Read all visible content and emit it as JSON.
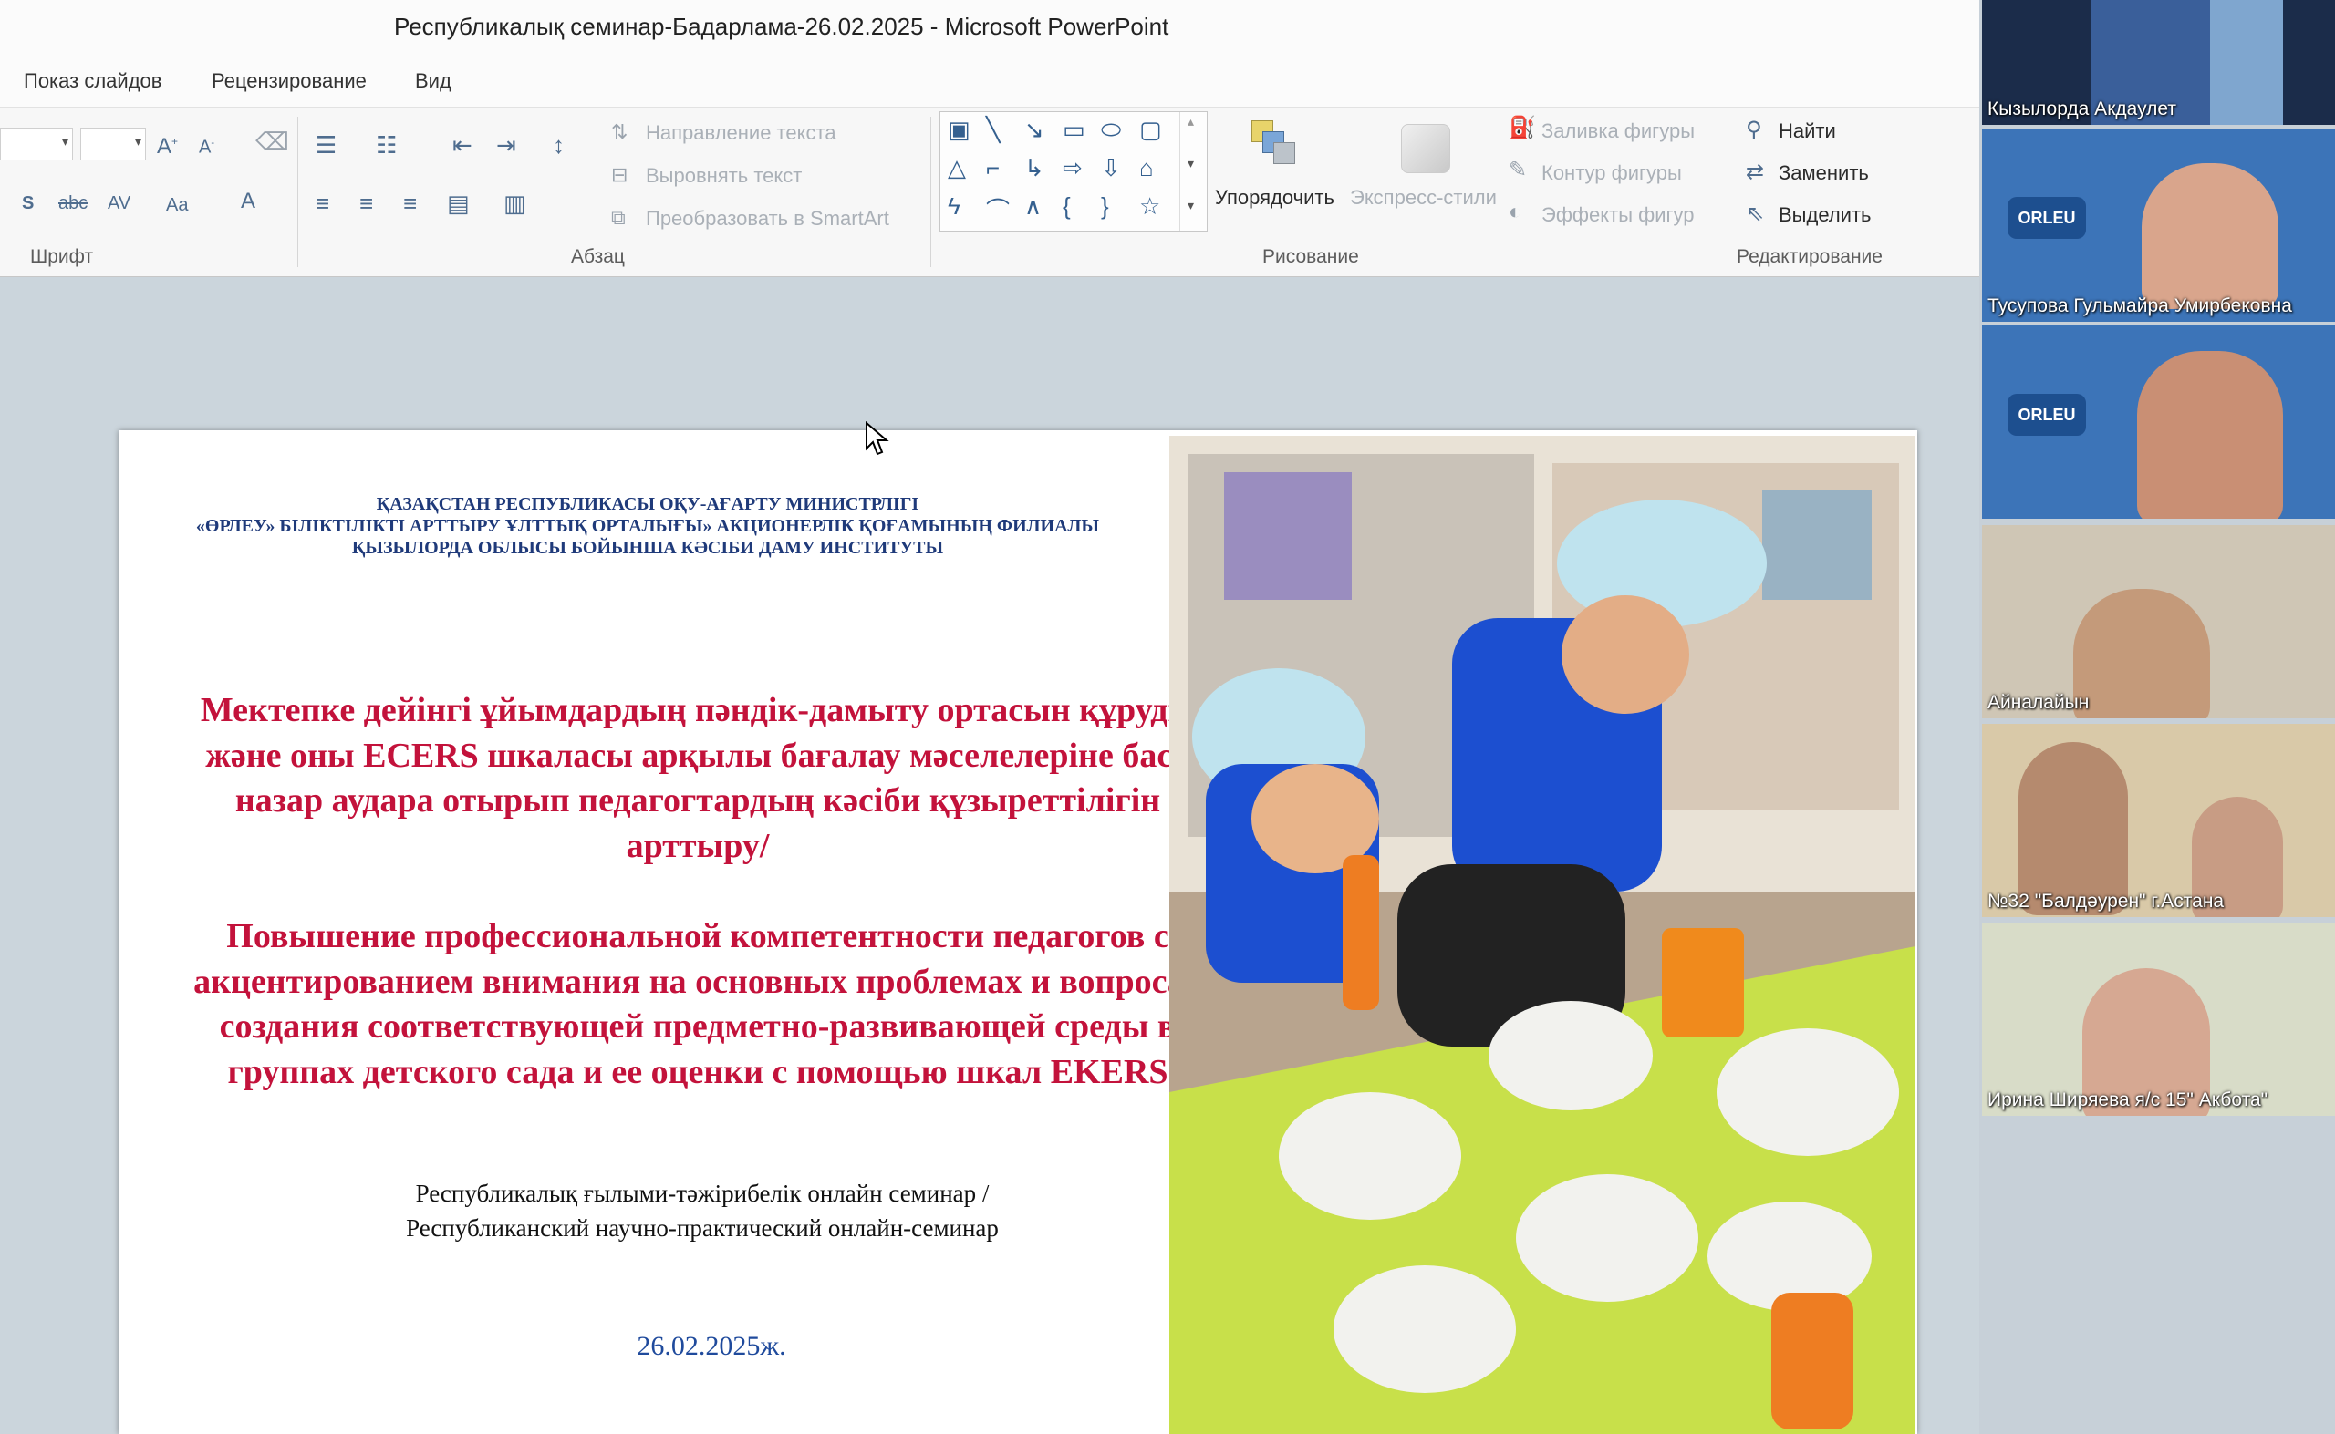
{
  "window": {
    "title": "Республикалық семинар-Бадарлама-26.02.2025  -  Microsoft PowerPoint"
  },
  "menu": {
    "items": [
      "Показ слайдов",
      "Рецензирование",
      "Вид"
    ]
  },
  "ribbon": {
    "groups": {
      "font": "Шрифт",
      "paragraph": "Абзац",
      "drawing": "Рисование",
      "editing": "Редактирование"
    },
    "paragraph": {
      "text_direction": "Направление текста",
      "align_text": "Выровнять текст",
      "smartart": "Преобразовать в SmartArt"
    },
    "drawing": {
      "arrange": "Упорядочить",
      "quick_styles": "Экспресс-стили",
      "shape_fill": "Заливка фигуры",
      "shape_outline": "Контур фигуры",
      "shape_effects": "Эффекты фигур"
    },
    "editing": {
      "find": "Найти",
      "replace": "Заменить",
      "select": "Выделить"
    }
  },
  "slide": {
    "header_lines": [
      "ҚАЗАҚСТАН РЕСПУБЛИКАСЫ ОҚУ-АҒАРТУ МИНИСТРЛІГІ",
      "«ӨРЛЕУ» БІЛІКТІЛІКТІ АРТТЫРУ ҰЛТТЫҚ ОРТАЛЫҒЫ» АКЦИОНЕРЛІК ҚОҒАМЫНЫҢ ФИЛИАЛЫ",
      "ҚЫЗЫЛОРДА ОБЛЫСЫ БОЙЫНША КӘСІБИ ДАМУ ИНСТИТУТЫ"
    ],
    "title_kz": "Мектепке дейінгі ұйымдардың пәндік-дамыту ортасын құруды және оны ECERS шкаласы арқылы бағалау мәселелеріне баса назар аудара отырып педагогтардың кәсіби құзыреттілігін арттыру/",
    "title_ru": "Повышение профессиональной компетентности педагогов с акцентированием внимания на основных проблемах и вопросах создания соответствующей предметно-развивающей среды в группах детского сада и ее оценки с помощью шкал EKERS",
    "seminar_kz": "Республикалық ғылыми-тәжірибелік онлайн семинар /",
    "seminar_ru": "Республиканский научно-практический онлайн-семинар",
    "date": "26.02.2025ж."
  },
  "participants": [
    {
      "name": "Кызылорда Акдаулет",
      "badge": ""
    },
    {
      "name": "Тусупова Гульмайра Умирбековна",
      "badge": "ORLEU"
    },
    {
      "name": "",
      "badge": "ORLEU"
    },
    {
      "name": "Айналайын",
      "badge": ""
    },
    {
      "name": "№32 \"Балдәурен\" г.Астана",
      "badge": ""
    },
    {
      "name": "Ирина Ширяева я/с 15\" Акбота\"",
      "badge": ""
    }
  ]
}
